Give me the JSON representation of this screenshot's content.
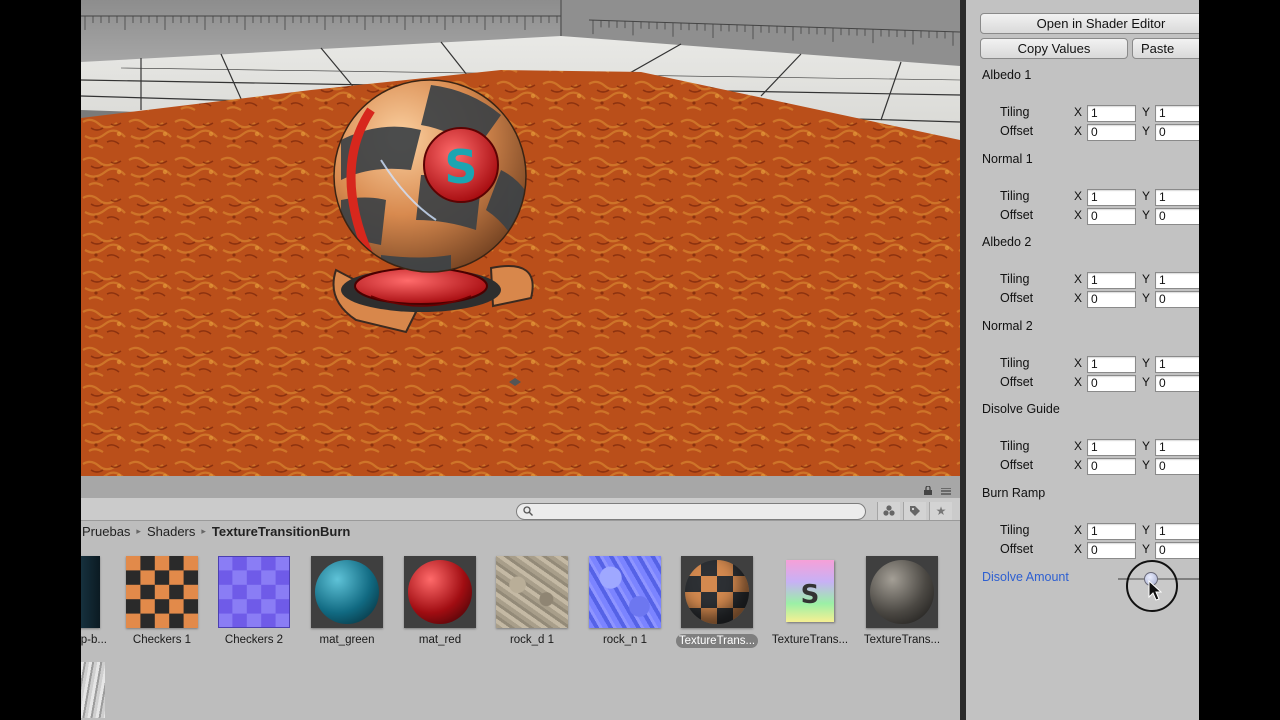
{
  "inspector": {
    "open_shader_editor": "Open in Shader Editor",
    "copy_values": "Copy Values",
    "paste": "Paste",
    "sections": [
      {
        "title": "Albedo 1",
        "tiling_x": "1",
        "tiling_y": "1",
        "offset_x": "0",
        "offset_y": "0"
      },
      {
        "title": "Normal 1",
        "tiling_x": "1",
        "tiling_y": "1",
        "offset_x": "0",
        "offset_y": "0"
      },
      {
        "title": "Albedo 2",
        "tiling_x": "1",
        "tiling_y": "1",
        "offset_x": "0",
        "offset_y": "0"
      },
      {
        "title": "Normal 2",
        "tiling_x": "1",
        "tiling_y": "1",
        "offset_x": "0",
        "offset_y": "0"
      },
      {
        "title": "Disolve Guide",
        "tiling_x": "1",
        "tiling_y": "1",
        "offset_x": "0",
        "offset_y": "0"
      },
      {
        "title": "Burn Ramp",
        "tiling_x": "1",
        "tiling_y": "1",
        "offset_x": "0",
        "offset_y": "0"
      }
    ],
    "tiling_label": "Tiling",
    "offset_label": "Offset",
    "x_label": "X",
    "y_label": "Y",
    "disolve_amount_label": "Disolve Amount",
    "disolve_amount_value": 0.4
  },
  "project": {
    "breadcrumb": [
      "Pruebas",
      "Shaders",
      "TextureTransitionBurn"
    ],
    "breadcrumb_separator": "▸",
    "search_placeholder": "",
    "assets": [
      {
        "label": "p-b...",
        "kind": "partial"
      },
      {
        "label": "Checkers 1",
        "kind": "checkers-orange"
      },
      {
        "label": "Checkers 2",
        "kind": "checkers-purple"
      },
      {
        "label": "mat_green",
        "kind": "sphere-teal"
      },
      {
        "label": "mat_red",
        "kind": "sphere-red"
      },
      {
        "label": "rock_d 1",
        "kind": "rock"
      },
      {
        "label": "rock_n 1",
        "kind": "normal"
      },
      {
        "label": "TextureTrans...",
        "kind": "sphere-checker",
        "selected": true
      },
      {
        "label": "TextureTrans...",
        "kind": "shader-icon"
      },
      {
        "label": "TextureTrans...",
        "kind": "sphere-dark"
      }
    ],
    "shader_icon_letter": "S"
  },
  "scene": {
    "logo_letter": "S"
  },
  "colors": {
    "accent_link": "#2d5fd1",
    "lava": "#c4541c"
  }
}
